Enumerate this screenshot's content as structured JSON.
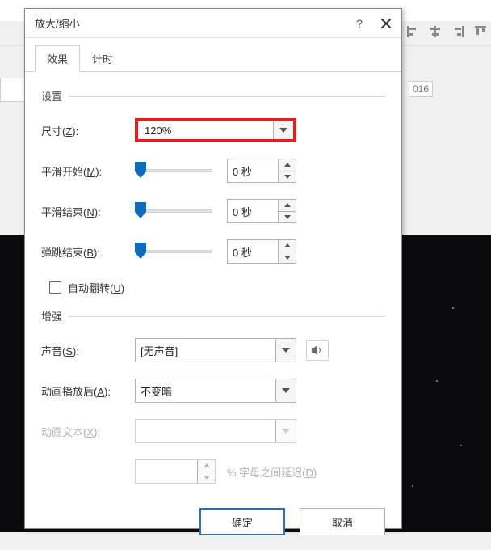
{
  "bg": {
    "timeline_marker": "016"
  },
  "dialog": {
    "title": "放大/缩小",
    "help": "?",
    "tabs": {
      "effect": "效果",
      "timing": "计时"
    },
    "groups": {
      "settings": "设置",
      "enhance": "增强"
    },
    "settings": {
      "size_label_pre": "尺寸(",
      "size_label_u": "Z",
      "size_label_post": "):",
      "size_value": "120%",
      "smooth_start_label_pre": "平滑开始(",
      "smooth_start_label_u": "M",
      "smooth_start_label_post": "):",
      "smooth_start_value": "0 秒",
      "smooth_end_label_pre": "平滑结束(",
      "smooth_end_label_u": "N",
      "smooth_end_label_post": "):",
      "smooth_end_value": "0 秒",
      "bounce_end_label_pre": "弹跳结束(",
      "bounce_end_label_u": "B",
      "bounce_end_label_post": "):",
      "bounce_end_value": "0 秒",
      "autoflip_label_pre": "自动翻转(",
      "autoflip_label_u": "U",
      "autoflip_label_post": ")"
    },
    "enhance": {
      "sound_label_pre": "声音(",
      "sound_label_u": "S",
      "sound_label_post": "):",
      "sound_value": "[无声音]",
      "after_label_pre": "动画播放后(",
      "after_label_u": "A",
      "after_label_post": "):",
      "after_value": "不变暗",
      "text_label_pre": "动画文本(",
      "text_label_u": "X",
      "text_label_post": "):",
      "text_value": "",
      "delay_value": "",
      "delay_label_pre": "% 字母之间延迟(",
      "delay_label_u": "D",
      "delay_label_post": ")"
    },
    "buttons": {
      "ok": "确定",
      "cancel": "取消"
    }
  }
}
